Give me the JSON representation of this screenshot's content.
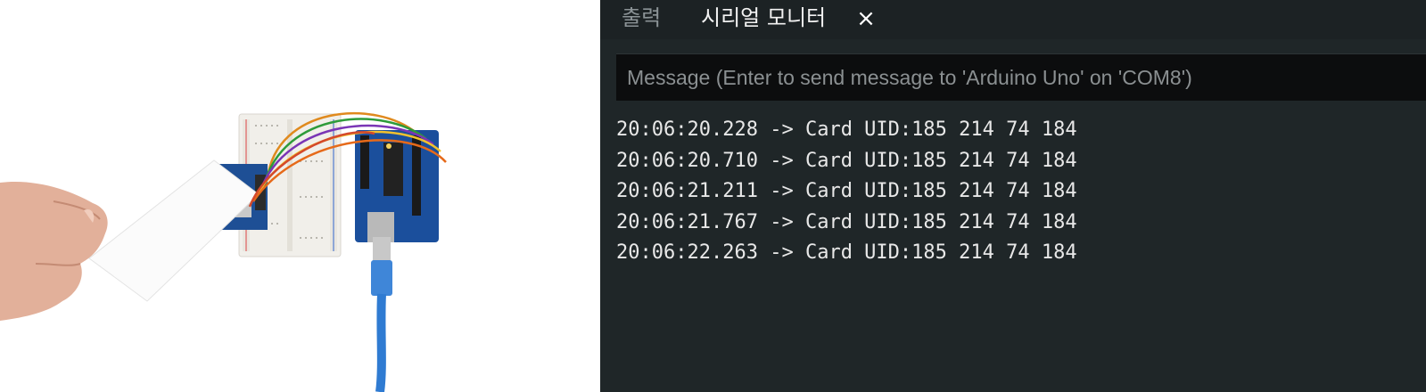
{
  "tabs": [
    {
      "label": "출력",
      "active": false
    },
    {
      "label": "시리얼 모니터",
      "active": true
    }
  ],
  "tab_close_glyph": "×",
  "message_input": {
    "placeholder": "Message (Enter to send message to 'Arduino Uno' on 'COM8')",
    "value": ""
  },
  "serial_output": [
    {
      "timestamp": "20:06:20.228",
      "arrow": "->",
      "text": "Card UID:185 214 74 184"
    },
    {
      "timestamp": "20:06:20.710",
      "arrow": "->",
      "text": "Card UID:185 214 74 184"
    },
    {
      "timestamp": "20:06:21.211",
      "arrow": "->",
      "text": "Card UID:185 214 74 184"
    },
    {
      "timestamp": "20:06:21.767",
      "arrow": "->",
      "text": "Card UID:185 214 74 184"
    },
    {
      "timestamp": "20:06:22.263",
      "arrow": "->",
      "text": "Card UID:185 214 74 184"
    }
  ],
  "colors": {
    "panel_bg": "#1f2628",
    "input_bg": "#0c0d0e",
    "arduino_blue": "#1b4f9c",
    "rfid_blue": "#1e4f95",
    "usb_cable": "#2f7bd2"
  },
  "icons": [
    "close-icon"
  ]
}
